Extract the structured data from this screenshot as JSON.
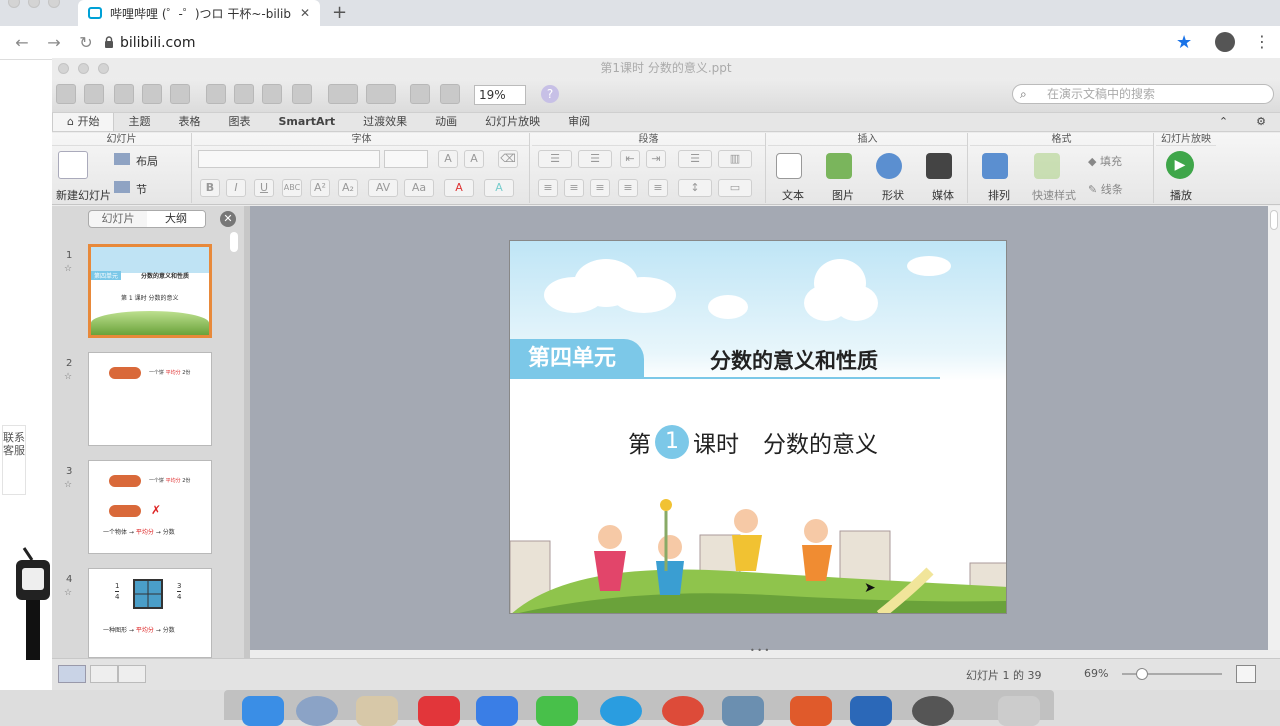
{
  "browser": {
    "tab_title": "哔哩哔哩 (゜-゜)つロ 干杯~-bilibili",
    "tab_close": "✕",
    "new_tab": "+",
    "url": "bilibili.com"
  },
  "left_page": {
    "customer_service": "联系客服"
  },
  "ppt": {
    "window_title": "第1课时  分数的意义.ppt",
    "zoom": "19%",
    "search_placeholder": "在演示文稿中的搜索",
    "tabs": [
      "开始",
      "主题",
      "表格",
      "图表",
      "SmartArt",
      "过渡效果",
      "动画",
      "幻灯片放映",
      "审阅"
    ],
    "groups": {
      "slides": "幻灯片",
      "font": "字体",
      "paragraph": "段落",
      "insert": "插入",
      "format": "格式",
      "slideshow": "幻灯片放映"
    },
    "buttons": {
      "new_slide": "新建幻灯片",
      "layout": "布局",
      "section": "节",
      "text": "文本",
      "picture": "图片",
      "shape": "形状",
      "media": "媒体",
      "arrange": "排列",
      "quick_styles": "快速样式",
      "fill": "填充",
      "line": "线条",
      "play": "播放"
    },
    "panel": {
      "tab_slides": "幻灯片",
      "tab_outline": "大纲"
    },
    "thumbnails": [
      {
        "num": "1",
        "title": "分数的意义和性质",
        "sub": "第 1 课时  分数的意义",
        "unit": "第四单元"
      },
      {
        "num": "2",
        "caption": "一个饼",
        "highlight": "平均分",
        "tail": "2份"
      },
      {
        "num": "3",
        "caption": "一个饼",
        "highlight": "平均分",
        "tail": "2份",
        "line": "一个物体",
        "line_hl": "平均分",
        "line_end": "分数"
      },
      {
        "num": "4",
        "f1": "1",
        "f1b": "4",
        "f2": "3",
        "f2b": "4",
        "line": "一种图形",
        "line_hl": "平均分",
        "line_end": "分数"
      }
    ],
    "slide": {
      "unit": "第四单元",
      "title": "分数的意义和性质",
      "lesson_prefix": "第",
      "lesson_num": "1",
      "lesson_suffix": "课时",
      "lesson_title": "分数的意义"
    },
    "status": {
      "slide_count": "幻灯片 1 的 39",
      "zoom": "69%"
    }
  },
  "colors": {
    "accent": "#7cc8e8",
    "orange": "#e8893a",
    "play": "#3fa64a",
    "bookmark": "#1a73e8"
  }
}
